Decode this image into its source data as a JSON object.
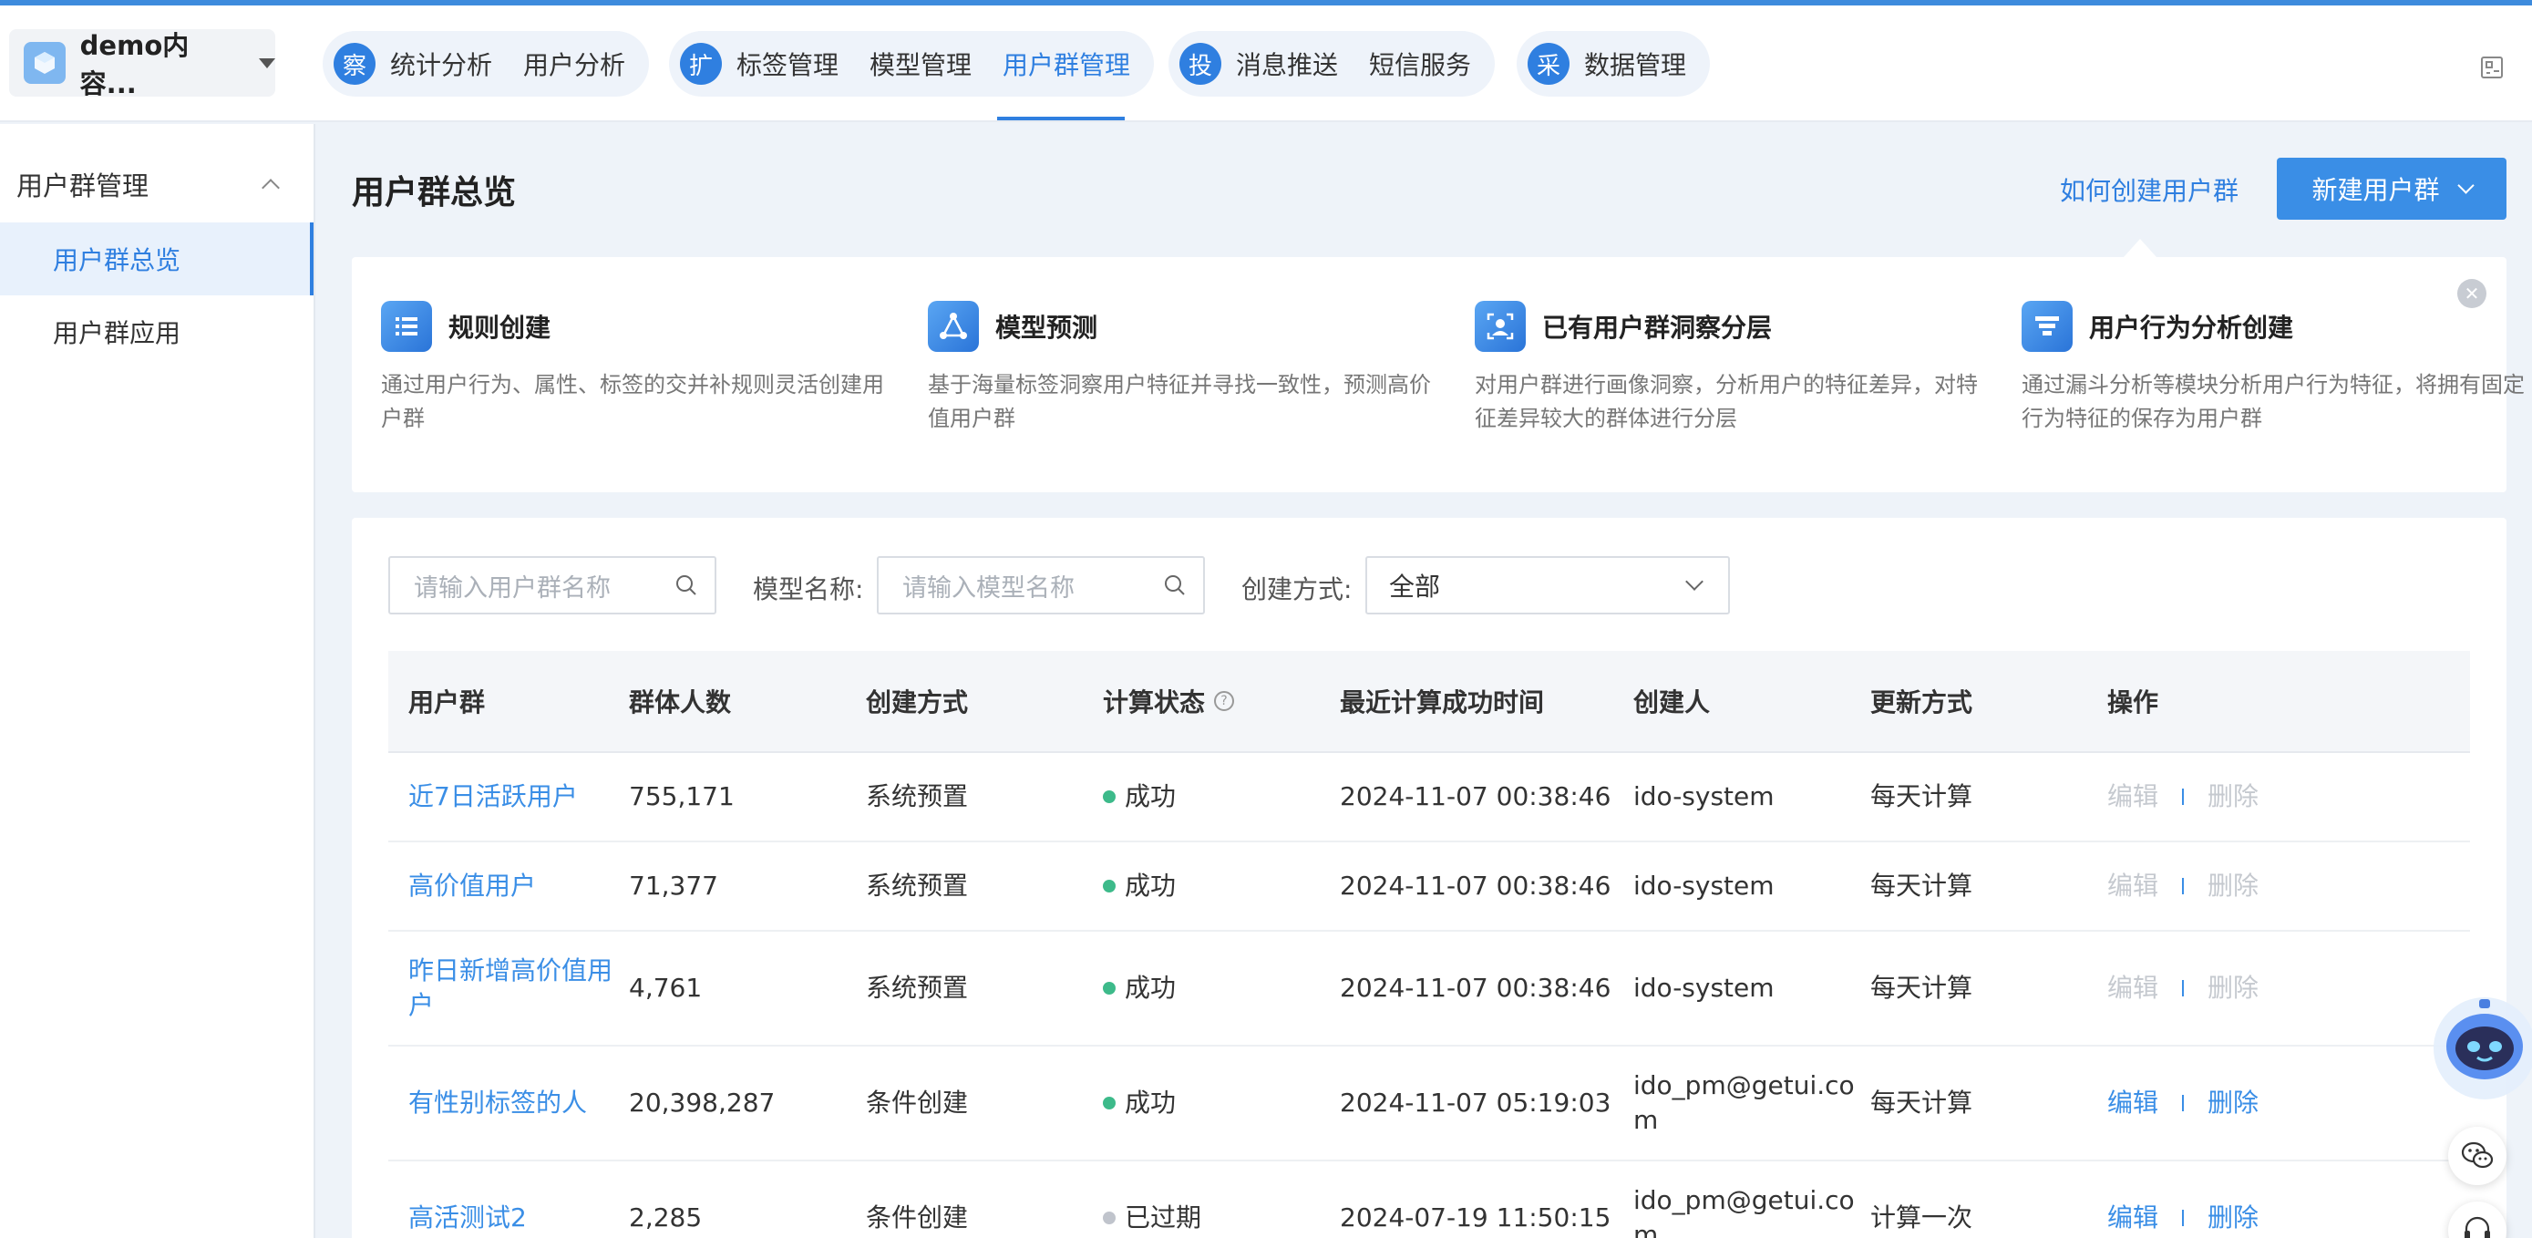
{
  "header": {
    "app_name": "demo内容...",
    "nav_groups": [
      {
        "badge": "察",
        "items": [
          "统计分析",
          "用户分析"
        ]
      },
      {
        "badge": "扩",
        "items": [
          "标签管理",
          "模型管理",
          "用户群管理"
        ]
      },
      {
        "badge": "投",
        "items": [
          "消息推送",
          "短信服务"
        ]
      },
      {
        "badge": "采",
        "items": [
          "数据管理"
        ]
      }
    ],
    "active_nav": "用户群管理"
  },
  "sidebar": {
    "group_label": "用户群管理",
    "items": [
      {
        "label": "用户群总览",
        "active": true
      },
      {
        "label": "用户群应用",
        "active": false
      }
    ]
  },
  "main": {
    "title": "用户群总览",
    "help_link": "如何创建用户群",
    "new_button": "新建用户群",
    "cards": [
      {
        "icon": "list-icon",
        "title": "规则创建",
        "desc": "通过用户行为、属性、标签的交并补规则灵活创建用户群"
      },
      {
        "icon": "network-icon",
        "title": "模型预测",
        "desc": "基于海量标签洞察用户特征并寻找一致性，预测高价值用户群"
      },
      {
        "icon": "portrait-scan-icon",
        "title": "已有用户群洞察分层",
        "desc": "对用户群进行画像洞察，分析用户的特征差异，对特征差异较大的群体进行分层"
      },
      {
        "icon": "funnel-icon",
        "title": "用户行为分析创建",
        "desc": "通过漏斗分析等模块分析用户行为特征，将拥有固定行为特征的保存为用户群"
      }
    ],
    "filters": {
      "group_placeholder": "请输入用户群名称",
      "model_label": "模型名称:",
      "model_placeholder": "请输入模型名称",
      "method_label": "创建方式:",
      "method_value": "全部"
    },
    "table": {
      "columns": [
        "用户群",
        "群体人数",
        "创建方式",
        "计算状态",
        "最近计算成功时间",
        "创建人",
        "更新方式",
        "操作"
      ],
      "edit_label": "编辑",
      "delete_label": "删除",
      "rows": [
        {
          "name": "近7日活跃用户",
          "count": "755,171",
          "method": "系统预置",
          "status": "成功",
          "time": "2024-11-07 00:38:46",
          "creator": "ido-system",
          "update": "每天计算",
          "ops_enabled": false
        },
        {
          "name": "高价值用户",
          "count": "71,377",
          "method": "系统预置",
          "status": "成功",
          "time": "2024-11-07 00:38:46",
          "creator": "ido-system",
          "update": "每天计算",
          "ops_enabled": false
        },
        {
          "name": "昨日新增高价值用户",
          "count": "4,761",
          "method": "系统预置",
          "status": "成功",
          "time": "2024-11-07 00:38:46",
          "creator": "ido-system",
          "update": "每天计算",
          "ops_enabled": false
        },
        {
          "name": "有性别标签的人",
          "count": "20,398,287",
          "method": "条件创建",
          "status": "成功",
          "time": "2024-11-07 05:19:03",
          "creator": "ido_pm@getui.com",
          "update": "每天计算",
          "ops_enabled": true
        },
        {
          "name": "高活测试2",
          "count": "2,285",
          "method": "条件创建",
          "status": "已过期",
          "time": "2024-07-19 11:50:15",
          "creator": "ido_pm@getui.com",
          "update": "计算一次",
          "ops_enabled": true
        }
      ]
    }
  },
  "colors": {
    "accent": "#2f7fe0",
    "success": "#3dba8a",
    "expired": "#c0c4cc"
  }
}
